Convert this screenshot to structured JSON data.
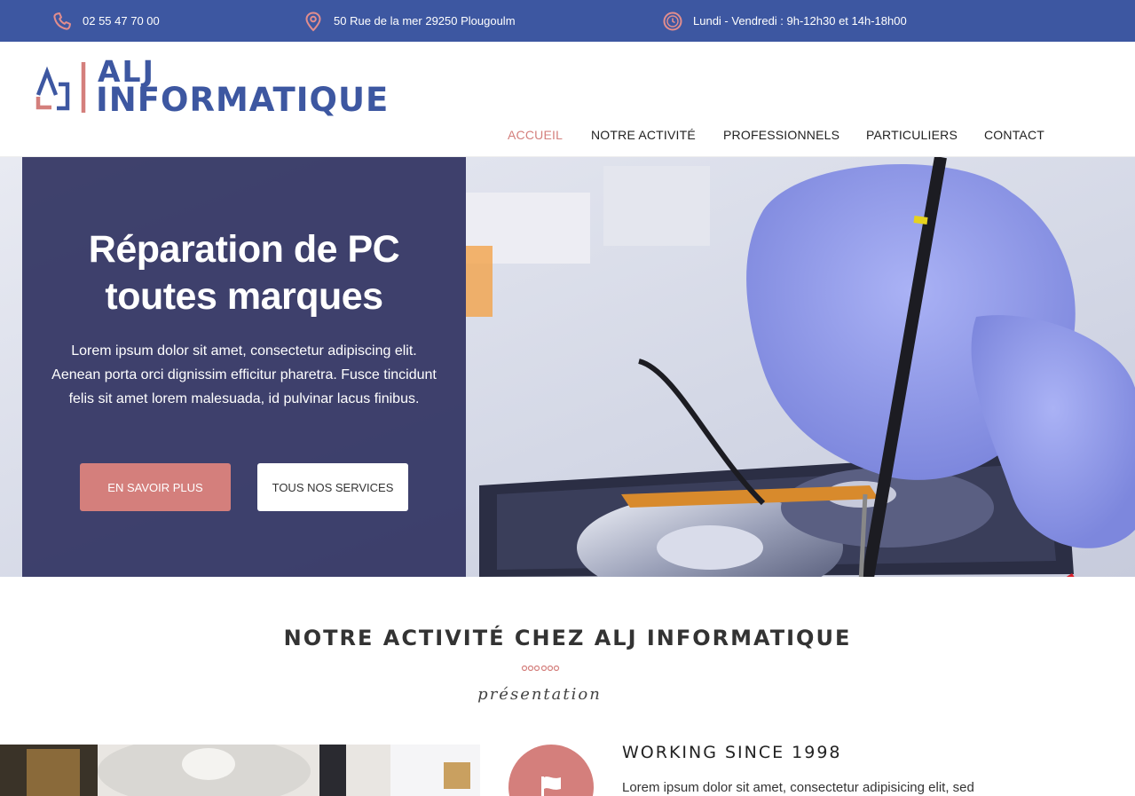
{
  "topbar": {
    "phone": "02 55 47 70 00",
    "address": "50 Rue de la mer 29250 Plougoulm",
    "hours": "Lundi - Vendredi : 9h-12h30 et 14h-18h00"
  },
  "logo": {
    "line1": "ALJ",
    "line2": "INFORMATIQUE"
  },
  "nav": {
    "items": [
      {
        "label": "ACCUEIL",
        "active": true
      },
      {
        "label": "NOTRE ACTIVITÉ",
        "active": false
      },
      {
        "label": "PROFESSIONNELS",
        "active": false
      },
      {
        "label": "PARTICULIERS",
        "active": false
      },
      {
        "label": "CONTACT",
        "active": false
      }
    ]
  },
  "hero": {
    "title_line1": "Réparation de PC",
    "title_line2": "toutes marques",
    "text": "Lorem ipsum dolor sit amet, consectetur adipiscing elit. Aenean porta orci dignissim efficitur pharetra. Fusce tincidunt felis sit amet lorem malesuada, id pulvinar lacus finibus.",
    "btn_primary": "EN SAVOIR PLUS",
    "btn_secondary": "TOUS NOS SERVICES"
  },
  "activity": {
    "title": "NOTRE ACTIVITÉ CHEZ ALJ INFORMATIQUE",
    "subtitle": "présentation",
    "feature_title": "WORKING SINCE 1998",
    "feature_text": "Lorem ipsum dolor sit amet, consectetur adipisicing elit, sed"
  },
  "colors": {
    "primary_blue": "#3d57a1",
    "accent_pink": "#d47f7c",
    "hero_panel": "#323462"
  },
  "icons": [
    "phone-icon",
    "map-pin-icon",
    "clock-icon",
    "flag-icon"
  ]
}
